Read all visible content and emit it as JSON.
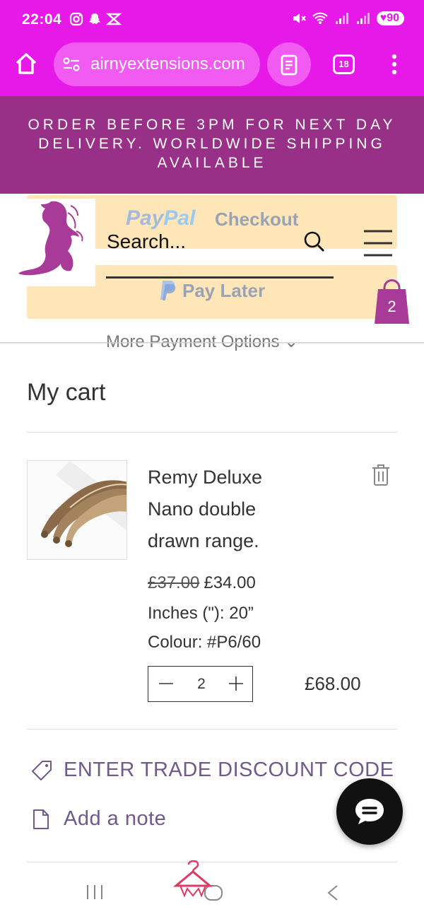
{
  "status_bar": {
    "time": "22:04",
    "battery": "90"
  },
  "browser": {
    "url": "airnyextensions.com",
    "tab_count": "18"
  },
  "announcement": {
    "line1": "ORDER BEFORE 3PM FOR NEXT DAY",
    "line2": "DELIVERY. WORLDWIDE SHIPPING",
    "line3": "AVAILABLE"
  },
  "payment": {
    "paypal_brand_1": "Pay",
    "paypal_brand_2": "Pal",
    "checkout": "Checkout",
    "pay_later": "Pay Later",
    "more_options": "More Payment Options ⌄"
  },
  "header": {
    "search_placeholder": "Search...",
    "cart_count": "2"
  },
  "cart": {
    "title": "My cart",
    "items": [
      {
        "name": "Remy Deluxe Nano double drawn range.",
        "old_price": "£37.00",
        "price": "£34.00",
        "option_inches": "Inches (\"): 20”",
        "option_colour": "Colour: #P6/60",
        "quantity": "2",
        "line_total": "£68.00"
      }
    ],
    "discount_label": "ENTER TRADE DISCOUNT CODE",
    "note_label": "Add a note"
  },
  "colors": {
    "browser_bar": "#e619e8",
    "announcement": "#983088",
    "brand_purple": "#a83b97",
    "paypal_button": "#ffe6b8"
  }
}
